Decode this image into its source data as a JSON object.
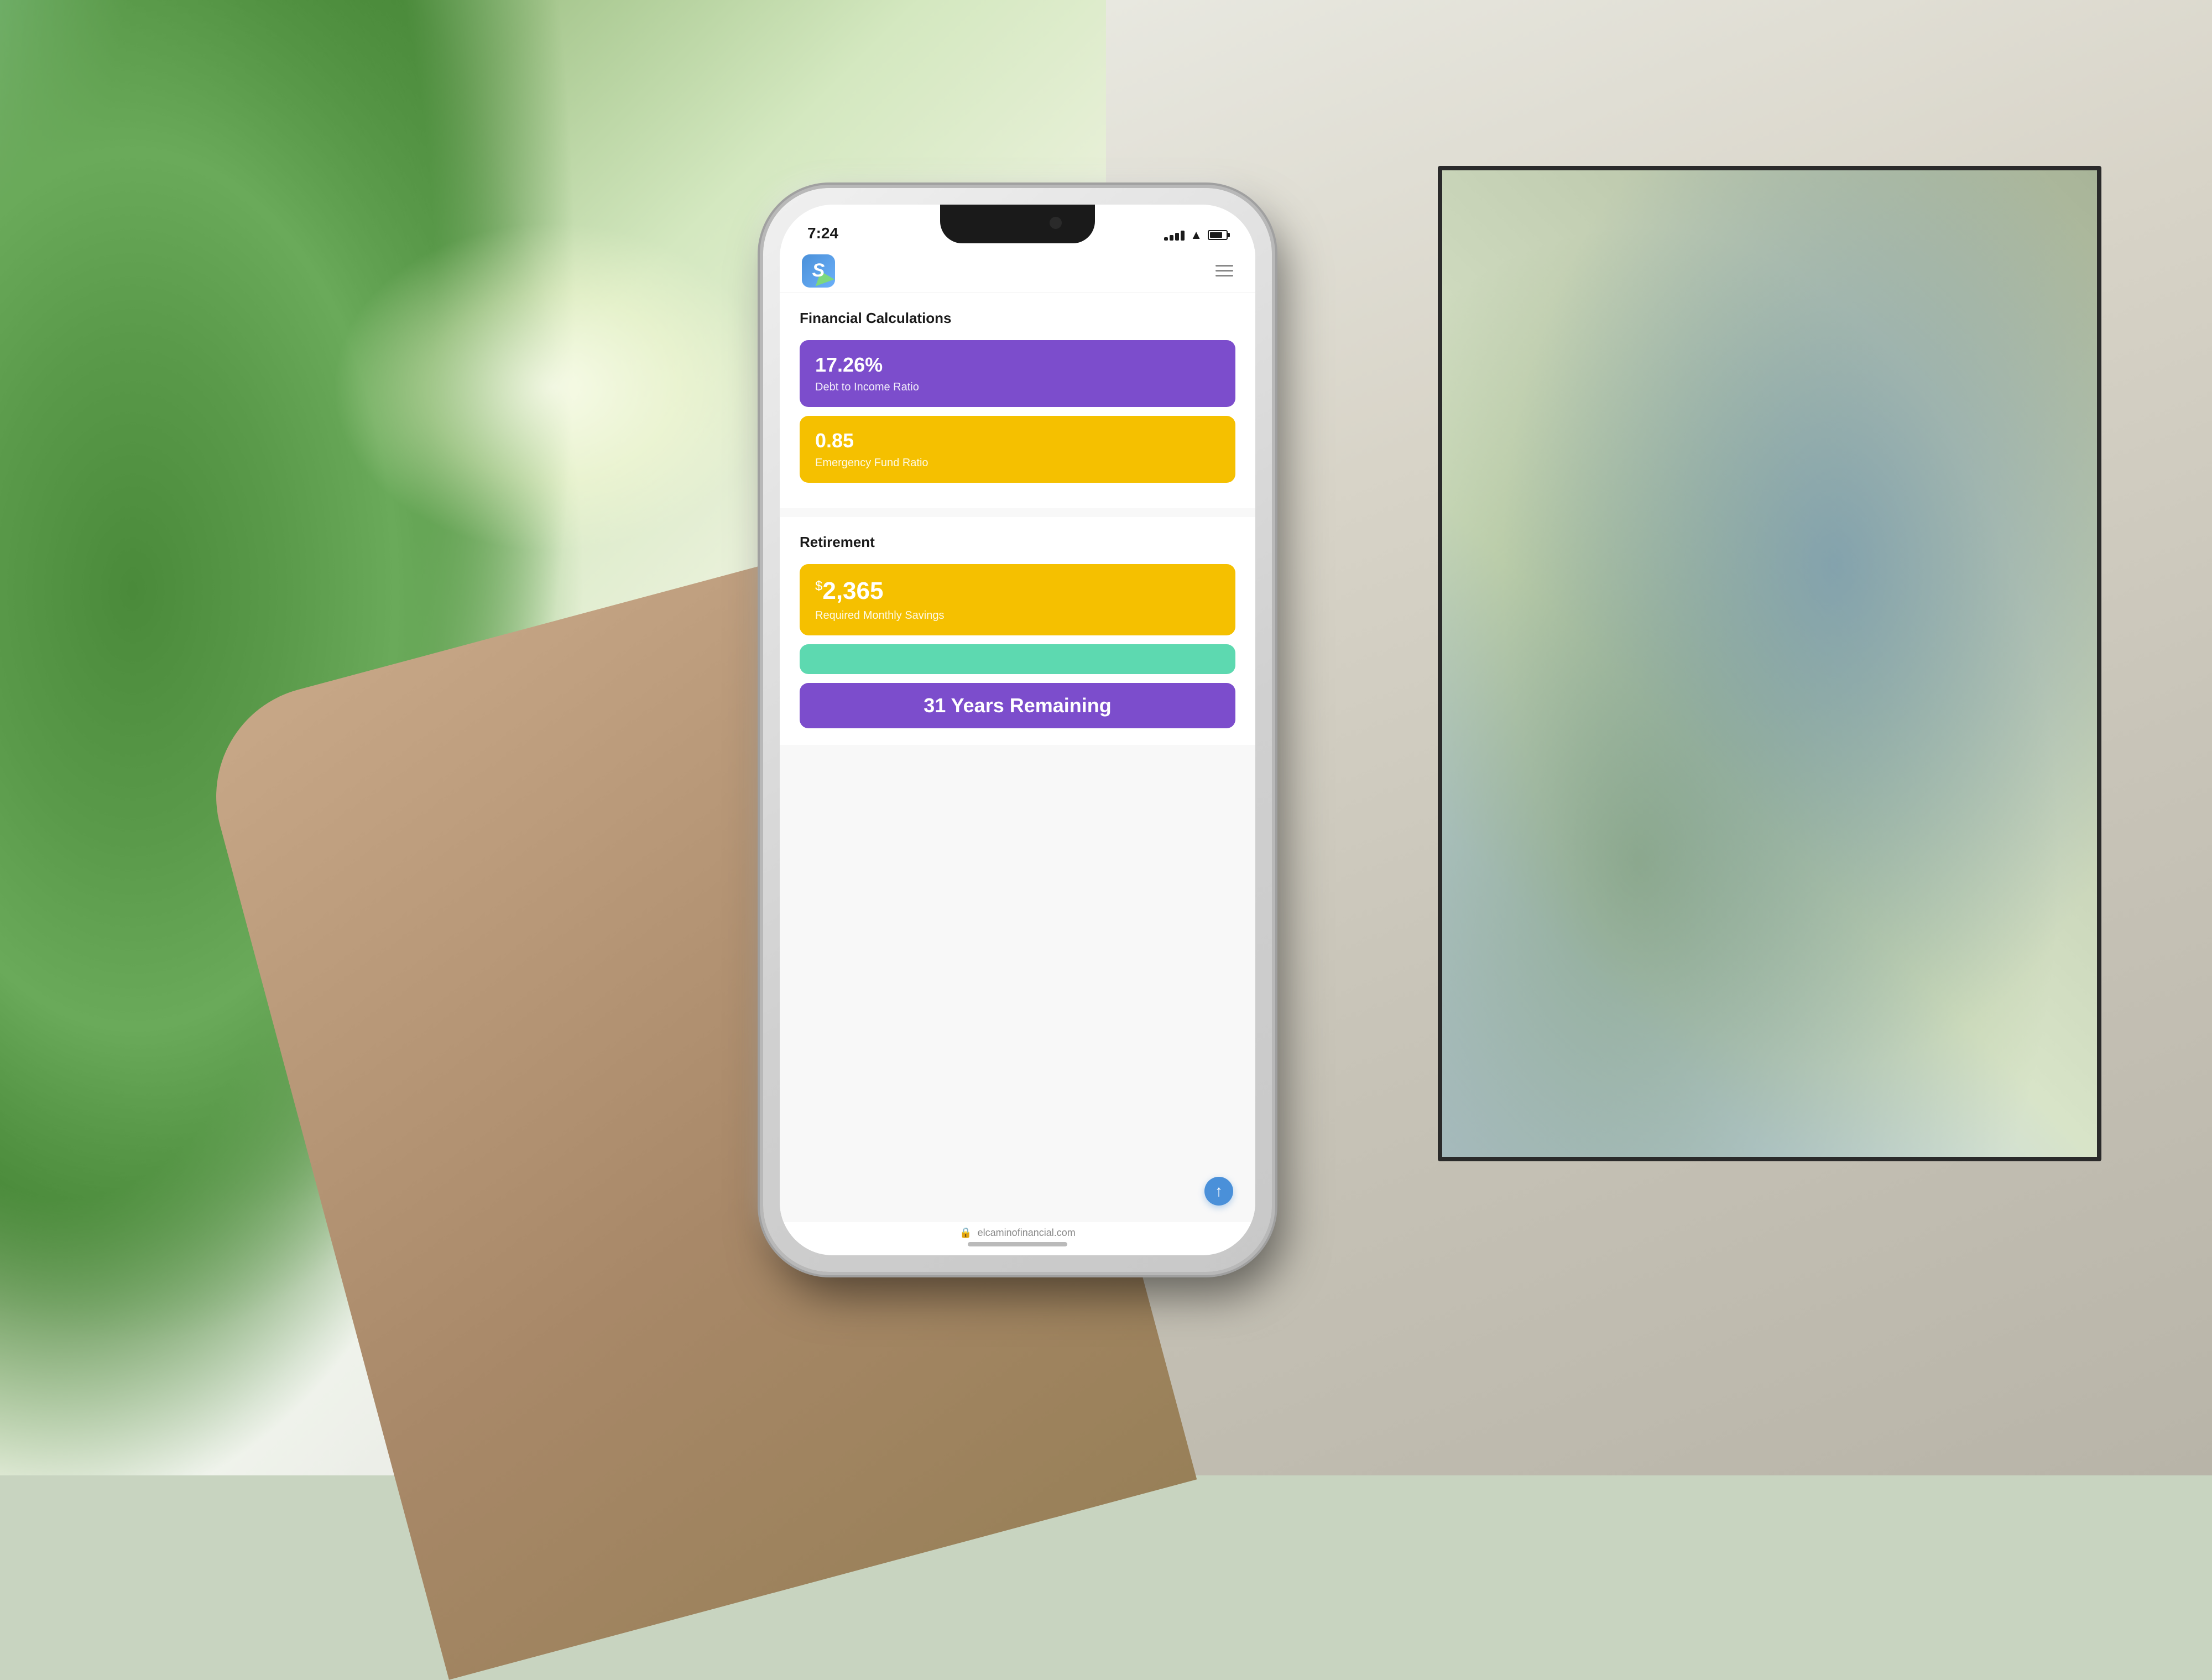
{
  "background": {
    "description": "Room with plants and map on wall, hand holding phone"
  },
  "status_bar": {
    "time": "7:24",
    "signal_label": "signal",
    "wifi_label": "wifi",
    "battery_label": "battery"
  },
  "header": {
    "logo_letter": "S",
    "menu_label": "menu"
  },
  "financial_section": {
    "title": "Financial Calculations",
    "debt_card": {
      "value": "17.26%",
      "label": "Debt to Income Ratio",
      "color": "#7c4dcc"
    },
    "emergency_card": {
      "value": "0.85",
      "label": "Emergency Fund Ratio",
      "color": "#f5c000"
    }
  },
  "retirement_section": {
    "title": "Retirement",
    "savings_card": {
      "prefix": "$",
      "value": "2,365",
      "label": "Required Monthly Savings",
      "color": "#f5c000"
    },
    "progress_card": {
      "color": "#5dd9b0"
    },
    "years_card": {
      "value": "31 Years Remaining",
      "color": "#7c4dcc"
    }
  },
  "url_bar": {
    "lock_icon": "🔒",
    "url": "elcaminofinancial.com"
  },
  "fab": {
    "icon": "↑",
    "label": "scroll-to-top"
  }
}
